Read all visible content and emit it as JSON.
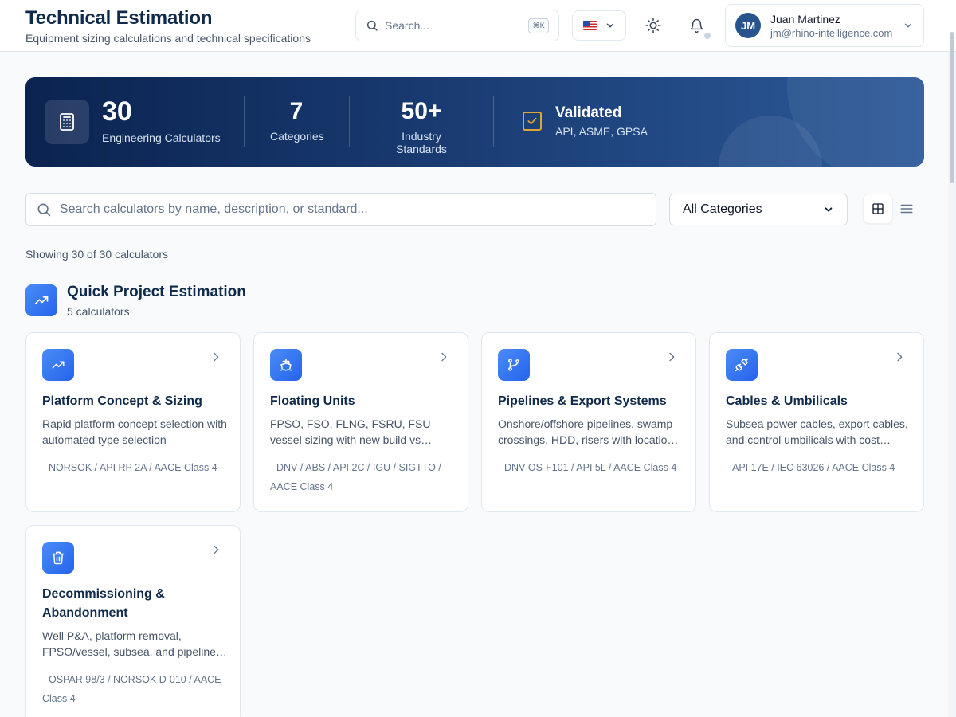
{
  "header": {
    "title": "Technical Estimation",
    "subtitle": "Equipment sizing calculations and technical specifications",
    "search_placeholder": "Search...",
    "search_shortcut": "⌘K",
    "language_flag": "us-flag-icon"
  },
  "user": {
    "initials": "JM",
    "name": "Juan Martinez",
    "email": "jm@rhino-intelligence.com"
  },
  "stats": {
    "calculators": {
      "value": "30",
      "label": "Engineering Calculators"
    },
    "categories": {
      "value": "7",
      "label": "Categories"
    },
    "standards": {
      "value": "50+",
      "label": "Industry Standards"
    },
    "validated": {
      "title": "Validated",
      "subtitle": "API, ASME, GPSA"
    }
  },
  "filters": {
    "search_placeholder": "Search calculators by name, description, or standard...",
    "category_selected": "All Categories",
    "view_mode": "grid"
  },
  "results": {
    "count_text": "Showing 30 of 30 calculators"
  },
  "section": {
    "title": "Quick Project Estimation",
    "count": "5 calculators",
    "icon": "trending-up-icon",
    "cards": [
      {
        "icon": "trending-up-icon",
        "title": "Platform Concept & Sizing",
        "description": "Rapid platform concept selection with automated type selection",
        "standards": "NORSOK / API RP 2A / AACE Class 4"
      },
      {
        "icon": "ship-icon",
        "title": "Floating Units",
        "description": "FPSO, FSO, FLNG, FSRU, FSU vessel sizing with new build vs conversion",
        "standards": "DNV / ABS / API 2C / IGU / SIGTTO / AACE Class 4"
      },
      {
        "icon": "git-branch-icon",
        "title": "Pipelines & Export Systems",
        "description": "Onshore/offshore pipelines, swamp crossings, HDD, risers with location factors",
        "standards": "DNV-OS-F101 / API 5L / AACE Class 4"
      },
      {
        "icon": "plug-icon",
        "title": "Cables & Umbilicals",
        "description": "Subsea power cables, export cables, and control umbilicals with cost estimation",
        "standards": "API 17E / IEC 63026 / AACE Class 4"
      },
      {
        "icon": "trash-icon",
        "title": "Decommissioning & Abandonment",
        "description": "Well P&A, platform removal, FPSO/vessel, subsea, and pipeline decommissioning",
        "standards": "OSPAR 98/3 / NORSOK D-010 / AACE Class 4"
      }
    ]
  },
  "colors": {
    "accent": "#2563eb",
    "hero_start": "#0b2350",
    "hero_end": "#2d5a99",
    "validated_check": "#e0a43a",
    "title_text": "#0f2a4a"
  }
}
